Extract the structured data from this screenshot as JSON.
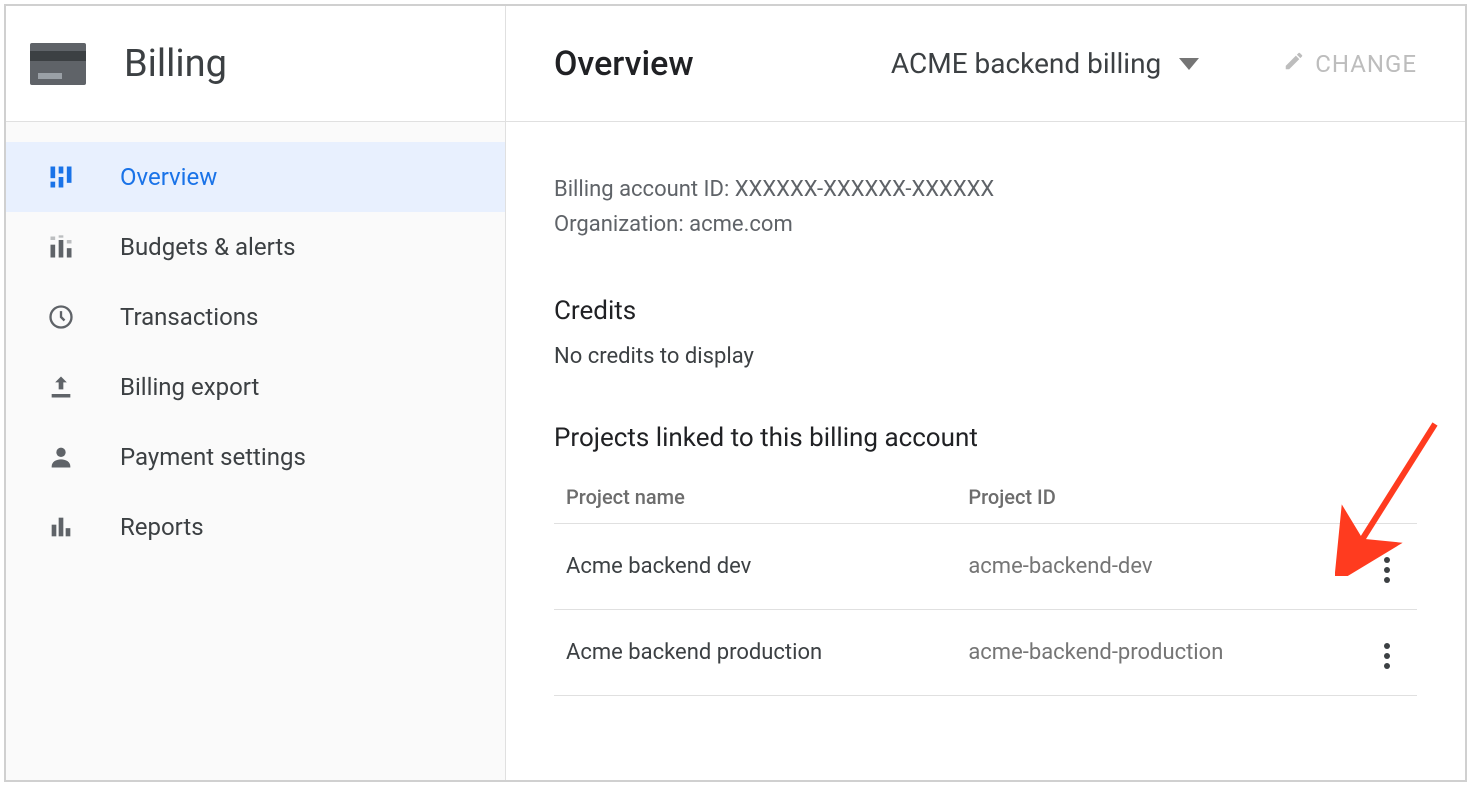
{
  "sidebar": {
    "title": "Billing",
    "items": [
      {
        "label": "Overview",
        "icon": "dashboard-icon",
        "active": true
      },
      {
        "label": "Budgets & alerts",
        "icon": "budgets-icon",
        "active": false
      },
      {
        "label": "Transactions",
        "icon": "clock-icon",
        "active": false
      },
      {
        "label": "Billing export",
        "icon": "upload-icon",
        "active": false
      },
      {
        "label": "Payment settings",
        "icon": "person-icon",
        "active": false
      },
      {
        "label": "Reports",
        "icon": "bar-chart-icon",
        "active": false
      }
    ]
  },
  "header": {
    "page_title": "Overview",
    "account_name": "ACME backend billing",
    "change_label": "CHANGE"
  },
  "overview": {
    "billing_account_id_label": "Billing account ID:",
    "billing_account_id_value": "XXXXXX-XXXXXX-XXXXXX",
    "organization_label": "Organization:",
    "organization_value": "acme.com",
    "credits_title": "Credits",
    "credits_empty": "No credits to display",
    "projects_title": "Projects linked to this billing account",
    "projects_columns": {
      "name": "Project name",
      "id": "Project ID"
    },
    "projects": [
      {
        "name": "Acme backend dev",
        "id": "acme-backend-dev"
      },
      {
        "name": "Acme backend production",
        "id": "acme-backend-production"
      }
    ]
  }
}
